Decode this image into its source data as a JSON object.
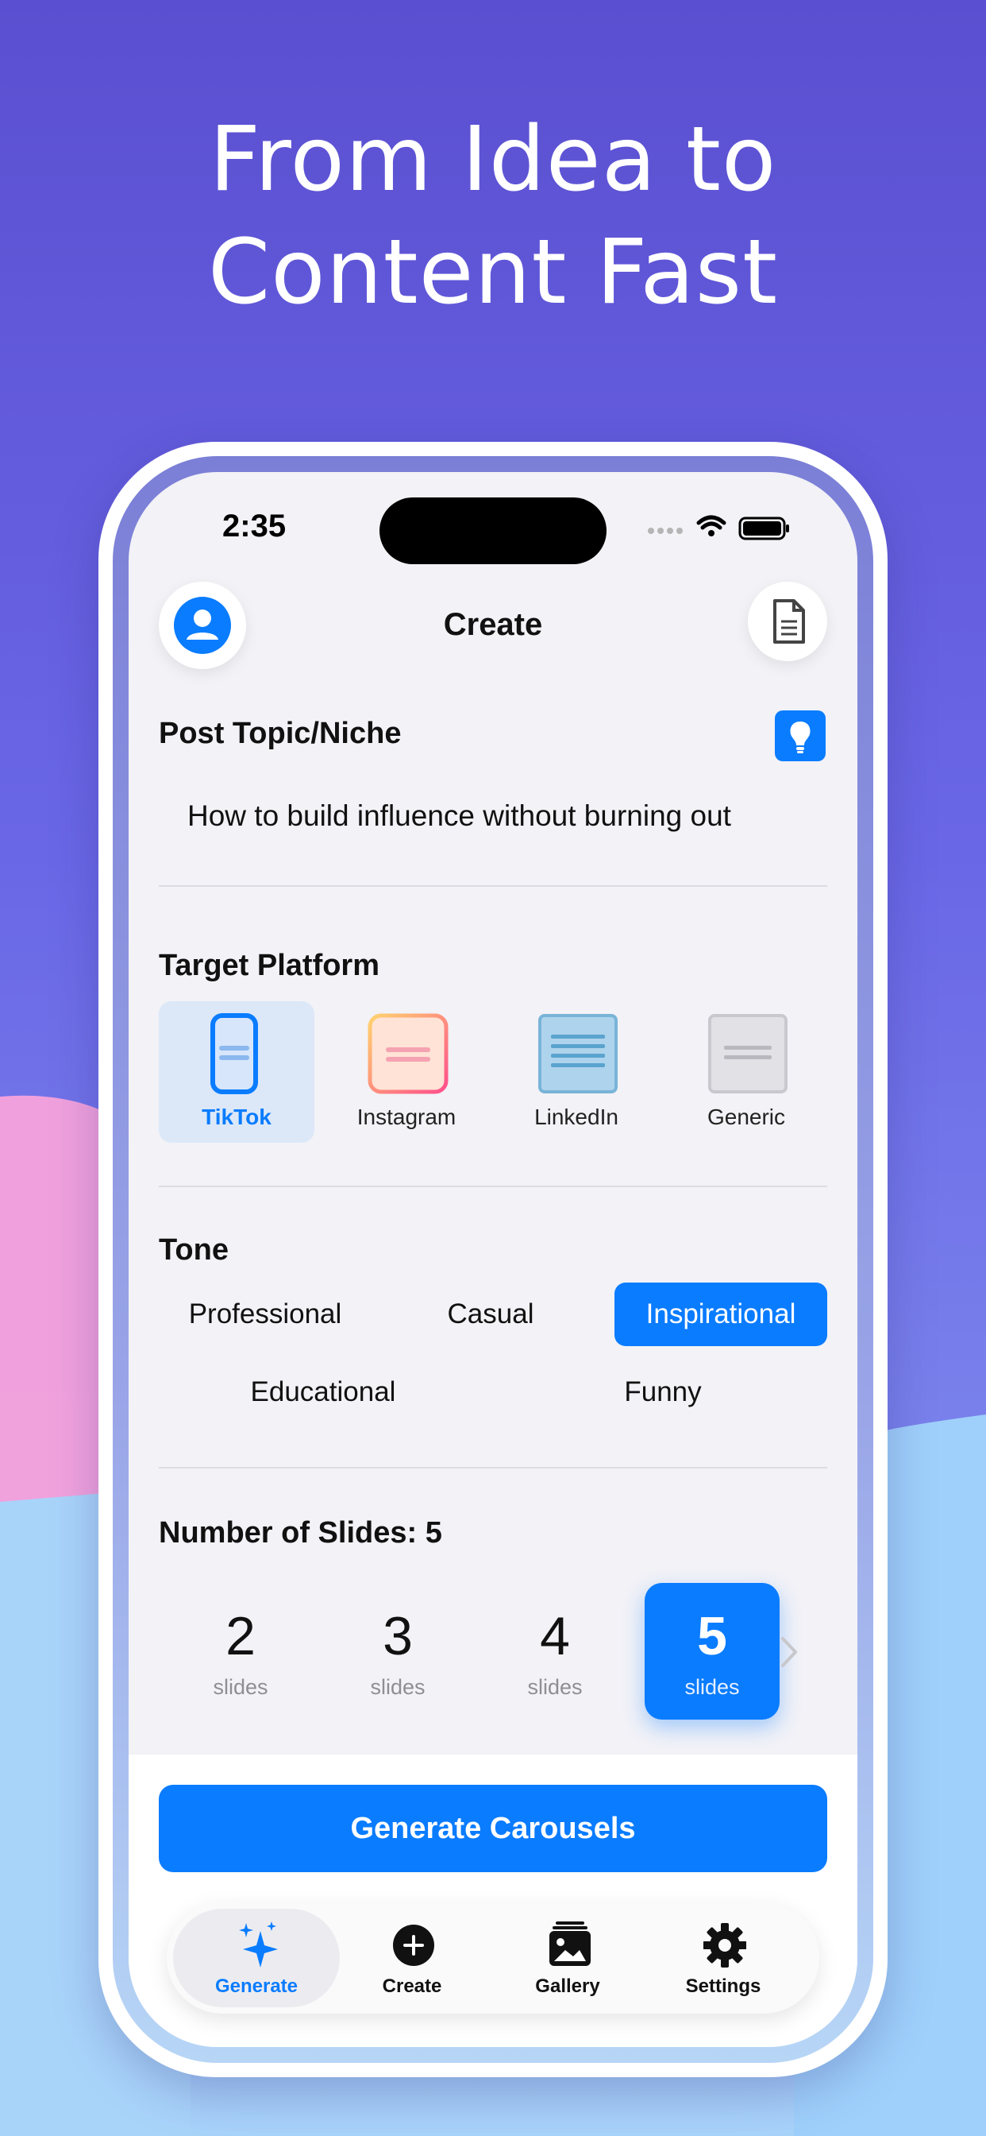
{
  "headline": {
    "line1": "From Idea to",
    "line2": "Content Fast"
  },
  "status": {
    "time": "2:35"
  },
  "nav": {
    "title": "Create",
    "avatar_icon": "person-icon",
    "doc_icon": "document-icon"
  },
  "topic": {
    "label": "Post Topic/Niche",
    "value": "How to build influence without burning out",
    "idea_icon": "lightbulb-icon"
  },
  "platform": {
    "label": "Target Platform",
    "options": [
      "TikTok",
      "Instagram",
      "LinkedIn",
      "Generic"
    ],
    "selected": "TikTok"
  },
  "tone": {
    "label": "Tone",
    "options": [
      "Professional",
      "Casual",
      "Inspirational",
      "Educational",
      "Funny"
    ],
    "selected": "Inspirational"
  },
  "slides": {
    "label": "Number of Slides: 5",
    "options": [
      {
        "count": "2",
        "unit": "slides"
      },
      {
        "count": "3",
        "unit": "slides"
      },
      {
        "count": "4",
        "unit": "slides"
      },
      {
        "count": "5",
        "unit": "slides"
      }
    ],
    "selected": "5"
  },
  "action": {
    "generate_label": "Generate Carousels"
  },
  "tabs": [
    {
      "label": "Generate",
      "icon": "sparkles-icon"
    },
    {
      "label": "Create",
      "icon": "plus-circle-icon"
    },
    {
      "label": "Gallery",
      "icon": "gallery-icon"
    },
    {
      "label": "Settings",
      "icon": "gear-icon"
    }
  ],
  "colors": {
    "accent": "#0a7cff",
    "background_top": "#5a4fd0",
    "background_bottom": "#a9d4fa"
  }
}
